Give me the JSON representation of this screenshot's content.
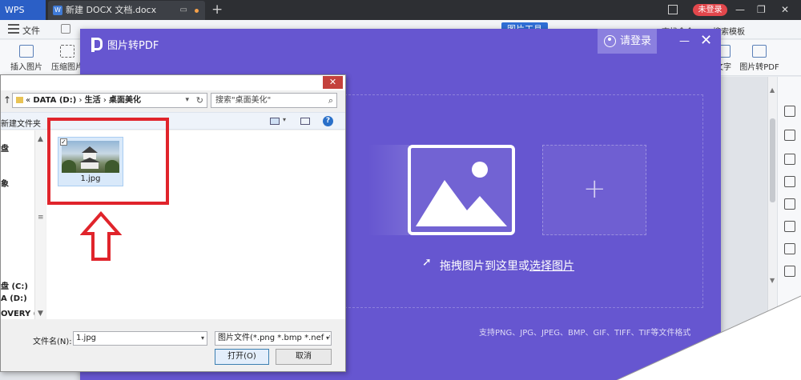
{
  "titlebar": {
    "app_tab": "WPS",
    "doc_tab": "新建 DOCX 文档.docx",
    "login_badge": "未登录"
  },
  "menubar": {
    "file_menu": "文件",
    "active_tab": "图片工具",
    "find_command": "查找命令",
    "templates": "搜索模板"
  },
  "ribbon": {
    "insert_picture": "插入图片",
    "compress_picture": "压缩图片",
    "to_text": "文字",
    "to_pdf": "图片转PDF"
  },
  "pdf_dialog": {
    "title": "图片转PDF",
    "login": "请登录",
    "drop_text": "拖拽图片到这里或",
    "select_link": "选择图片",
    "formats": "支持PNG、JPG、JPEG、BMP、GIF、TIFF、TIF等文件格式",
    "plus": "+"
  },
  "file_dialog": {
    "address": {
      "prefix": "«",
      "drive": "DATA (D:)",
      "sep": "›",
      "folder1": "生活",
      "folder2": "桌面美化"
    },
    "search_placeholder": "搜索\"桌面美化\"",
    "new_folder": "新建文件夹",
    "nav_items": [
      {
        "label": "盘"
      },
      {
        "label": "象"
      },
      {
        "label": "盘 (C:)"
      },
      {
        "label": "A (D:)"
      },
      {
        "label": "OVERY (E:)"
      }
    ],
    "file": {
      "name": "1.jpg"
    },
    "filename_label": "文件名(N):",
    "filename_value": "1.jpg",
    "filetype_value": "图片文件(*.png *.bmp *.nef *.c",
    "open_button": "打开(O)",
    "cancel_button": "取消"
  },
  "colors": {
    "dialog_purple": "#6656d0",
    "annotation_red": "#e0242b",
    "accent_blue": "#2f6fd6"
  }
}
